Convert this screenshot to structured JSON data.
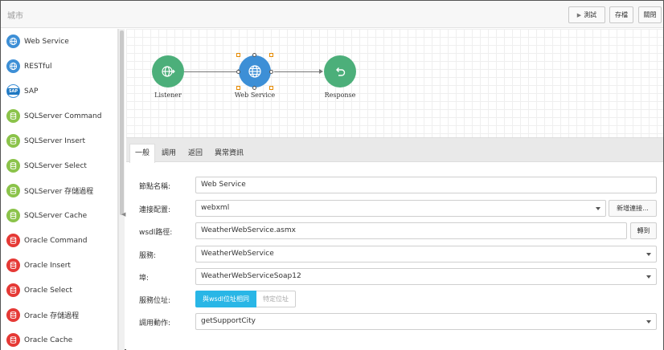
{
  "header": {
    "title": "城市",
    "buttons": {
      "test": "測試",
      "save": "存檔",
      "close": "關閉"
    }
  },
  "sidebar": {
    "items": [
      {
        "label": "Web Service",
        "icon": "globe-icon",
        "color": "#3d8fd6"
      },
      {
        "label": "RESTful",
        "icon": "globe-icon",
        "color": "#3d8fd6"
      },
      {
        "label": "SAP",
        "icon": "sap-icon",
        "color": "#1e78c2"
      },
      {
        "label": "SQLServer Command",
        "icon": "database-icon",
        "color": "#8bc34a"
      },
      {
        "label": "SQLServer Insert",
        "icon": "database-icon",
        "color": "#8bc34a"
      },
      {
        "label": "SQLServer Select",
        "icon": "database-icon",
        "color": "#8bc34a"
      },
      {
        "label": "SQLServer 存儲過程",
        "icon": "database-icon",
        "color": "#8bc34a"
      },
      {
        "label": "SQLServer Cache",
        "icon": "database-icon",
        "color": "#8bc34a"
      },
      {
        "label": "Oracle Command",
        "icon": "database-icon",
        "color": "#e53935"
      },
      {
        "label": "Oracle Insert",
        "icon": "database-icon",
        "color": "#e53935"
      },
      {
        "label": "Oracle Select",
        "icon": "database-icon",
        "color": "#e53935"
      },
      {
        "label": "Oracle 存儲過程",
        "icon": "database-icon",
        "color": "#e53935"
      },
      {
        "label": "Oracle Cache",
        "icon": "database-icon",
        "color": "#e53935"
      }
    ]
  },
  "flow": {
    "nodes": [
      {
        "label": "Listener",
        "icon": "globe-arrow-icon",
        "color": "#4caf7a"
      },
      {
        "label": "Web Service",
        "icon": "globe-icon",
        "color": "#3d8fd6",
        "selected": true
      },
      {
        "label": "Response",
        "icon": "return-arrow-icon",
        "color": "#4caf7a"
      }
    ]
  },
  "tabs": [
    "一般",
    "調用",
    "返回",
    "異常資訊"
  ],
  "form": {
    "node_name_label": "節點名稱:",
    "node_name_value": "Web Service",
    "connection_label": "連接配置:",
    "connection_value": "webxml",
    "new_connection_button": "新增連接...",
    "wsdl_label": "wsdl路徑:",
    "wsdl_value": "WeatherWebService.asmx",
    "goto_button": "轉到",
    "service_label": "服務:",
    "service_value": "WeatherWebService",
    "port_label": "埠:",
    "port_value": "WeatherWebServiceSoap12",
    "service_address_label": "服務位址:",
    "address_option_same": "與wsdl位址相同",
    "address_option_specific": "特定位址",
    "action_label": "調用動作:",
    "action_value": "getSupportCity"
  },
  "colors": {
    "accent": "#29b6e6",
    "green_node": "#4caf7a",
    "blue_node": "#3d8fd6"
  }
}
